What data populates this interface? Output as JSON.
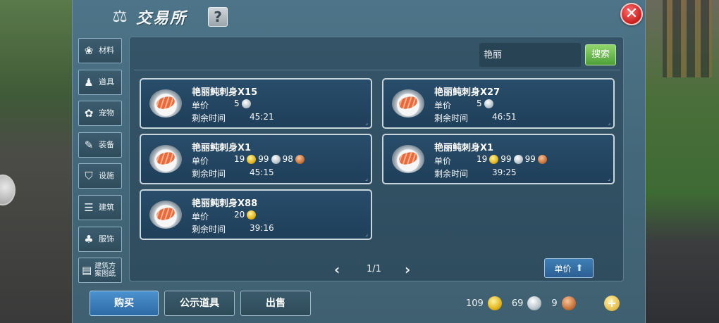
{
  "header": {
    "title": "交易所",
    "title_icon": "scale-icon",
    "help_label": "?",
    "close_label": "✕"
  },
  "categories": [
    {
      "label": "材料",
      "icon": "materials-icon",
      "glyph": "❀"
    },
    {
      "label": "道具",
      "icon": "potion-icon",
      "glyph": "♟"
    },
    {
      "label": "宠物",
      "icon": "paw-icon",
      "glyph": "✿"
    },
    {
      "label": "装备",
      "icon": "equipment-icon",
      "glyph": "✎"
    },
    {
      "label": "设施",
      "icon": "facility-icon",
      "glyph": "⛉"
    },
    {
      "label": "建筑",
      "icon": "building-icon",
      "glyph": "☰"
    },
    {
      "label": "服饰",
      "icon": "clothing-icon",
      "glyph": "♣"
    },
    {
      "label": "建筑方案图纸",
      "icon": "blueprint-icon",
      "glyph": "▤"
    }
  ],
  "search": {
    "value": "艳丽",
    "button_label": "搜索"
  },
  "labels": {
    "unit_price": "单价",
    "time_left": "剩余时间"
  },
  "listings": [
    {
      "name": "艳丽鲀刺身X15",
      "price": [
        {
          "amount": "5",
          "coin": "silver"
        }
      ],
      "time": "45:21"
    },
    {
      "name": "艳丽鲀刺身X27",
      "price": [
        {
          "amount": "5",
          "coin": "silver"
        }
      ],
      "time": "46:51"
    },
    {
      "name": "艳丽鲀刺身X1",
      "price": [
        {
          "amount": "19",
          "coin": "gold"
        },
        {
          "amount": "99",
          "coin": "silver"
        },
        {
          "amount": "98",
          "coin": "copper"
        }
      ],
      "time": "45:15"
    },
    {
      "name": "艳丽鲀刺身X1",
      "price": [
        {
          "amount": "19",
          "coin": "gold"
        },
        {
          "amount": "99",
          "coin": "silver"
        },
        {
          "amount": "99",
          "coin": "copper"
        }
      ],
      "time": "39:25"
    },
    {
      "name": "艳丽鲀刺身X88",
      "price": [
        {
          "amount": "20",
          "coin": "gold"
        }
      ],
      "time": "39:16"
    }
  ],
  "pager": {
    "prev": "‹",
    "next": "›",
    "text": "1/1"
  },
  "sort": {
    "label": "单价",
    "arrow": "⬆"
  },
  "actions": {
    "buy": "购买",
    "public_items": "公示道具",
    "sell": "出售"
  },
  "wallet": {
    "gold": "109",
    "silver": "69",
    "copper": "9",
    "add": "+"
  }
}
